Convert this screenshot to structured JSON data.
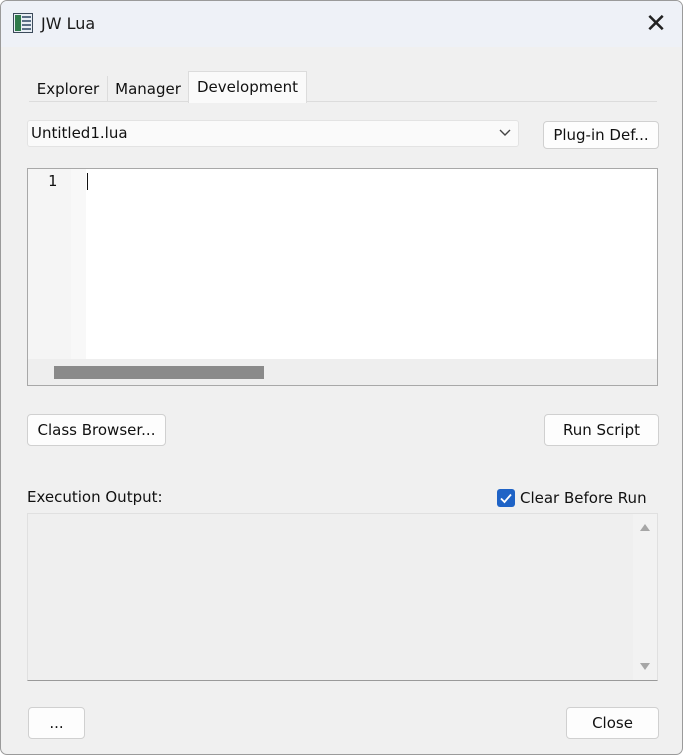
{
  "window": {
    "title": "JW Lua",
    "close_glyph": "✕"
  },
  "tabs": [
    {
      "label": "Explorer",
      "active": false
    },
    {
      "label": "Manager",
      "active": false
    },
    {
      "label": "Development",
      "active": true
    }
  ],
  "script_select": {
    "selected": "Untitled1.lua"
  },
  "buttons": {
    "plugin_def": "Plug-in Def...",
    "class_browser": "Class Browser...",
    "run_script": "Run Script",
    "more": "...",
    "close": "Close"
  },
  "editor": {
    "line_numbers": [
      "1"
    ],
    "content": ""
  },
  "output": {
    "label": "Execution Output:",
    "clear_before_run_label": "Clear Before Run",
    "clear_before_run_checked": true,
    "text": ""
  },
  "icons": {
    "app": "jw-lua-app-icon",
    "close": "close-icon",
    "dropdown": "chevron-down-icon",
    "checkbox": "checkmark-icon"
  },
  "colors": {
    "accent": "#1f63c6",
    "window_bg": "#f0f0f0",
    "titlebar_bg": "#eef1f7"
  }
}
